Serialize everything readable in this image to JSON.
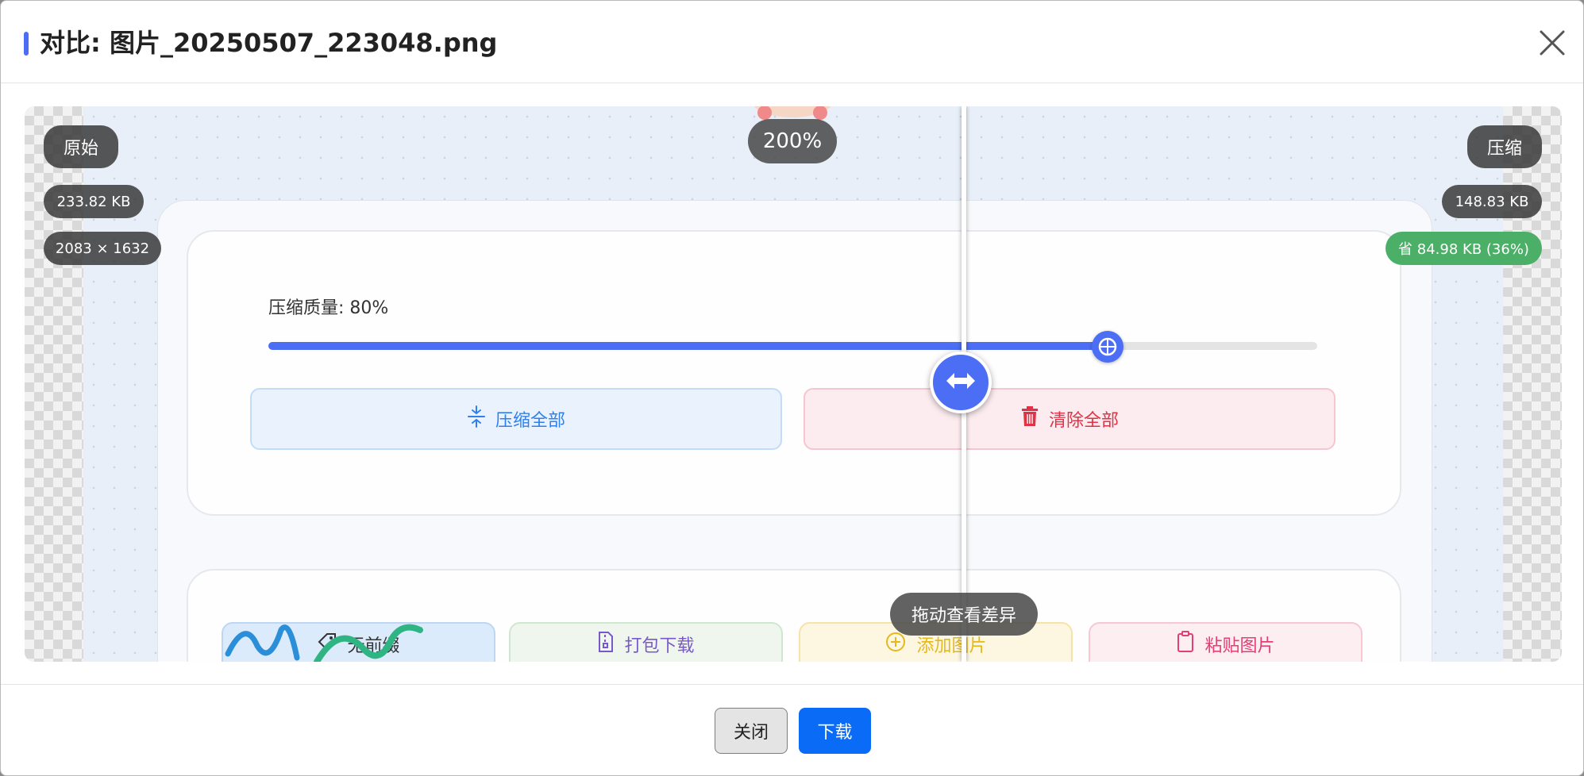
{
  "dialog": {
    "title": "对比: 图片_20250507_223048.png",
    "accent_color": "#4c6ef5"
  },
  "viewer": {
    "original": {
      "tag": "原始",
      "size": "233.82 KB",
      "dimensions": "2083 × 1632"
    },
    "compressed": {
      "tag": "压缩",
      "size": "148.83 KB",
      "savings": "省 84.98 KB (36%)"
    },
    "zoom_level": "200%",
    "drag_hint": "拖动查看差异",
    "divider_position": 0.5
  },
  "preview": {
    "quality_label": "压缩质量: 80%",
    "quality_value": 80,
    "buttons": {
      "compress_all": "压缩全部",
      "clear_all": "清除全部"
    },
    "tools": {
      "no_prefix": "无前缀",
      "pack_download": "打包下载",
      "add_image": "添加图片",
      "paste_image": "粘贴图片"
    }
  },
  "footer": {
    "close_label": "关闭",
    "download_label": "下载",
    "download_color": "#0a6cf6"
  },
  "icons": {
    "close": "close-icon",
    "swap": "swap-arrows-icon",
    "compress": "compress-icon",
    "trash": "trash-icon",
    "tag": "tag-icon",
    "archive": "file-zip-icon",
    "add": "plus-circle-icon",
    "clipboard": "clipboard-icon"
  }
}
